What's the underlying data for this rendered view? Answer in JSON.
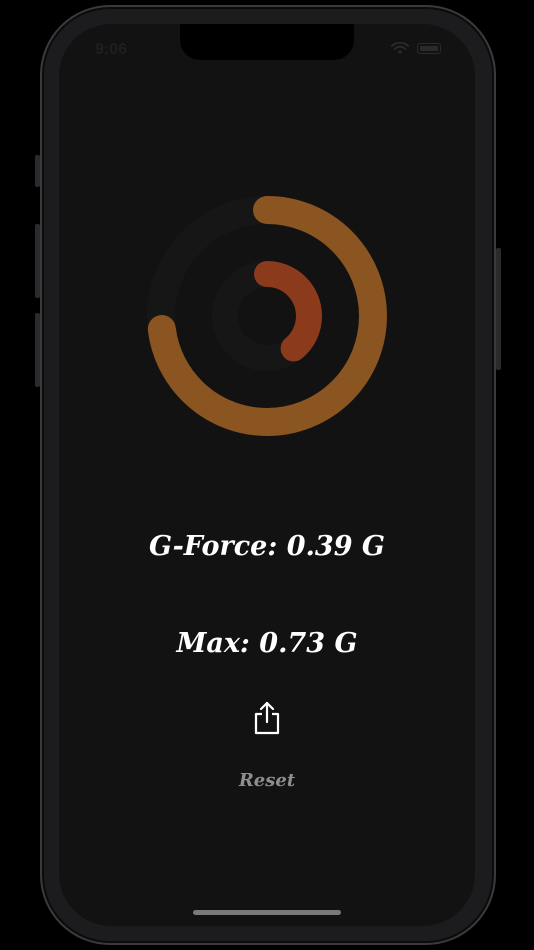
{
  "status_bar": {
    "time": "9:06"
  },
  "rings": {
    "current_fraction": 0.39,
    "max_fraction": 0.73,
    "current_color": "#8c3a1c",
    "max_color": "#8a5520",
    "track_color": "#161616"
  },
  "readouts": {
    "gforce_label": "G-Force: 0.39 G",
    "max_label": "Max: 0.73 G"
  },
  "actions": {
    "share_icon": "share-icon",
    "reset_label": "Reset"
  },
  "colors": {
    "background": "#121212",
    "text": "#ffffff",
    "reset_text": "#8e8e8e"
  }
}
